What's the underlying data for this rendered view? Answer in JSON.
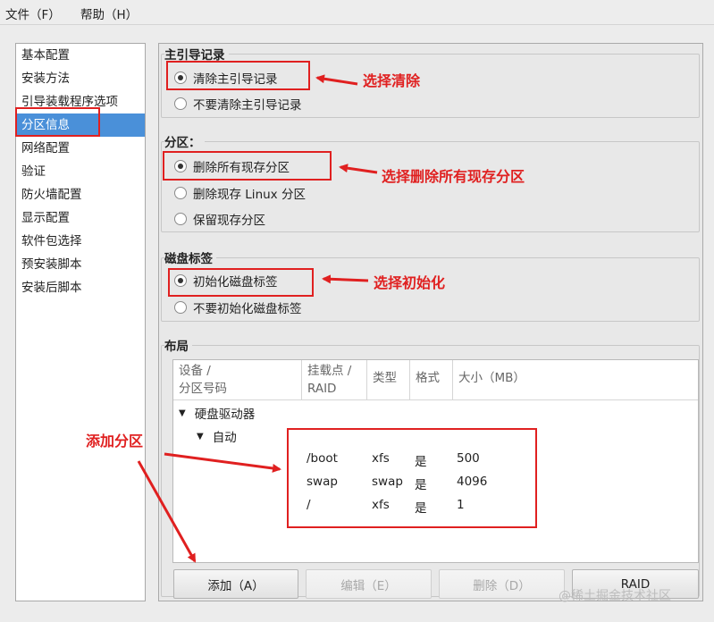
{
  "menu": {
    "file": "文件（F）",
    "help": "帮助（H）"
  },
  "sidebar": {
    "items": [
      "基本配置",
      "安装方法",
      "引导装载程序选项",
      "分区信息",
      "网络配置",
      "验证",
      "防火墙配置",
      "显示配置",
      "软件包选择",
      "预安装脚本",
      "安装后脚本"
    ],
    "selected": "分区信息"
  },
  "mbr": {
    "title": "主引导记录",
    "options": [
      "清除主引导记录",
      "不要清除主引导记录"
    ],
    "selected": "清除主引导记录"
  },
  "partition": {
    "title": "分区：",
    "options": [
      "删除所有现存分区",
      "删除现存 Linux 分区",
      "保留现存分区"
    ],
    "selected": "删除所有现存分区"
  },
  "disklabel": {
    "title": "磁盘标签",
    "options": [
      "初始化磁盘标签",
      "不要初始化磁盘标签"
    ],
    "selected": "初始化磁盘标签"
  },
  "layout": {
    "title": "布局",
    "columns": [
      {
        "line1": "设备 /",
        "line2": "分区号码"
      },
      {
        "line1": "挂载点 /",
        "line2": "RAID"
      },
      {
        "line1": "类型",
        "line2": ""
      },
      {
        "line1": "格式",
        "line2": ""
      },
      {
        "line1": "大小（MB）",
        "line2": ""
      }
    ],
    "tree_root": "硬盘驱动器",
    "tree_child": "自动",
    "rows": [
      {
        "mount": "/boot",
        "type": "xfs",
        "format": "是",
        "size": "500"
      },
      {
        "mount": "swap",
        "type": "swap",
        "format": "是",
        "size": "4096"
      },
      {
        "mount": "/",
        "type": "xfs",
        "format": "是",
        "size": "1"
      }
    ]
  },
  "buttons": {
    "add": "添加（A）",
    "edit": "编辑（E）",
    "delete": "删除（D）",
    "raid": "RAID"
  },
  "annotations": {
    "clear": "选择清除",
    "delete_all": "选择删除所有现存分区",
    "init": "选择初始化",
    "add_partition": "添加分区"
  },
  "watermark": "@稀土掘金技术社区",
  "colors": {
    "annotation": "#e02020",
    "selection": "#4a90d9"
  }
}
